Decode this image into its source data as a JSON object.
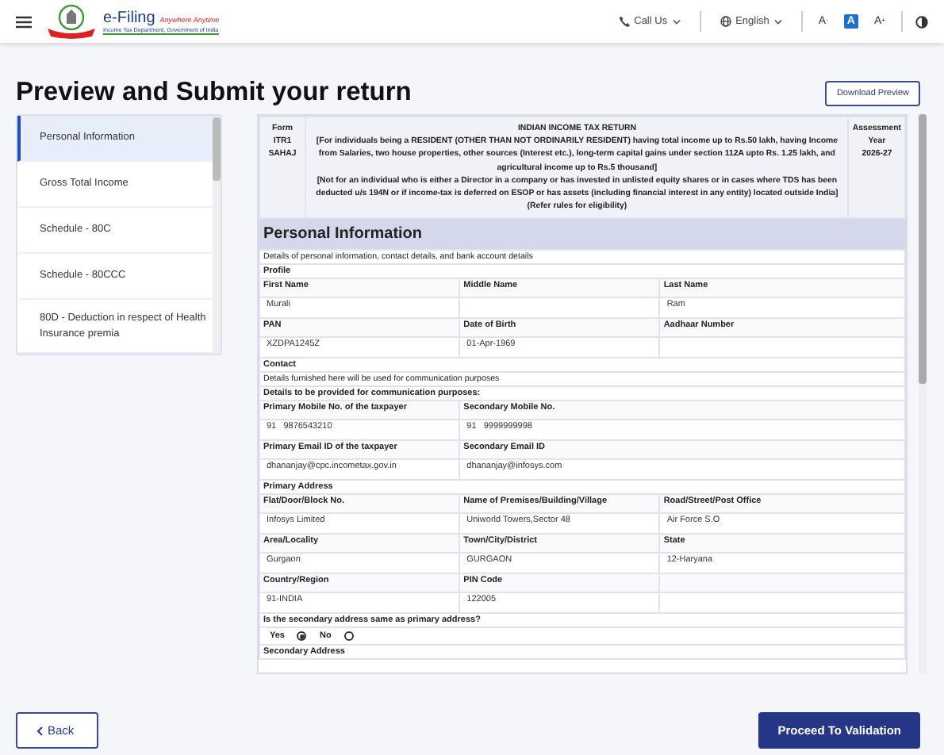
{
  "header": {
    "brand": "e-Filing",
    "tagline": "Anywhere Anytime",
    "subtitle": "Income Tax Department, Government of India",
    "call_us": "Call Us",
    "language": "English",
    "font_controls": [
      {
        "label": "A",
        "sign": "-",
        "selected": false
      },
      {
        "label": "A",
        "selected": true
      },
      {
        "label": "A",
        "sign": "+",
        "selected": false
      }
    ]
  },
  "page_title": "Preview and Submit your return",
  "download_button": "Download Preview",
  "sidebar": {
    "items": [
      {
        "label": "Personal Information",
        "selected": true
      },
      {
        "label": "Gross Total Income",
        "selected": false
      },
      {
        "label": "Schedule - 80C",
        "selected": false
      },
      {
        "label": "Schedule - 80CCC",
        "selected": false
      },
      {
        "label": "80D - Deduction in respect of Health Insurance premia",
        "selected": false
      }
    ]
  },
  "form": {
    "form_lines": [
      "Form",
      "ITR1",
      "SAHAJ"
    ],
    "title": "INDIAN INCOME TAX RETURN",
    "paragraphs": [
      "[For individuals being a RESIDENT (OTHER THAN NOT ORDINARILY RESIDENT) having total income up to Rs.50 lakh, having Income from Salaries, two house properties, other sources (Interest etc.), long-term capital gains under section 112A upto Rs. 1.25 lakh, and agricultural income up to Rs.5 thousand]",
      "[Not for an individual who is either a Director in a company or has invested in unlisted equity shares or in cases where TDS has been deducted u/s 194N or if income-tax is deferred on ESOP or has assets (including financial interest in any entity) located outside India]",
      "(Refer rules for eligibility)"
    ],
    "ay_lines": [
      "Assessment",
      "Year",
      "2026-27"
    ],
    "section_title": "Personal Information",
    "section_note": "Details of personal information, contact details, and bank account details",
    "rows": [
      {
        "kind": "heading",
        "text": "Profile"
      },
      {
        "kind": "labels",
        "cells": [
          {
            "text": "First Name"
          },
          {
            "text": "Middle Name"
          },
          {
            "text": "Last Name"
          }
        ]
      },
      {
        "kind": "values",
        "cells": [
          {
            "text": "Murali"
          },
          {},
          {
            "text": "Ram"
          }
        ]
      },
      {
        "kind": "labels",
        "cells": [
          {
            "text": "PAN"
          },
          {
            "text": "Date of Birth"
          },
          {
            "text": "Aadhaar Number"
          }
        ]
      },
      {
        "kind": "values",
        "cells": [
          {
            "text": "XZDPA1245Z"
          },
          {
            "text": "01-Apr-1969"
          },
          {}
        ]
      },
      {
        "kind": "heading",
        "text": "Contact"
      },
      {
        "kind": "note",
        "text": "Details furnished here will be used for communication purposes"
      },
      {
        "kind": "heading",
        "text": "Details to be provided for communication purposes:"
      },
      {
        "kind": "labels",
        "cells": [
          {
            "text": "Primary Mobile No. of the taxpayer"
          },
          {
            "text": "Secondary Mobile No."
          }
        ]
      },
      {
        "kind": "values",
        "cells": [
          {
            "text": "91   9876543210"
          },
          {
            "text": "91   9999999998"
          }
        ]
      },
      {
        "kind": "labels",
        "cells": [
          {
            "text": "Primary Email ID of the taxpayer"
          },
          {
            "text": "Secondary Email ID"
          }
        ]
      },
      {
        "kind": "values",
        "cells": [
          {
            "text": "dhananjay@cpc.incometax.gov.in"
          },
          {
            "text": "dhananjay@infosys.com"
          }
        ]
      },
      {
        "kind": "heading",
        "text": "Primary Address"
      },
      {
        "kind": "labels",
        "cells": [
          {
            "text": "Flat/Door/Block No."
          },
          {
            "text": "Name of Premises/Building/Village"
          },
          {
            "text": "Road/Street/Post Office"
          }
        ]
      },
      {
        "kind": "values",
        "cells": [
          {
            "text": "Infosys Limited"
          },
          {
            "text": "Uniworld Towers,Sector 48"
          },
          {
            "text": "Air Force S.O"
          }
        ]
      },
      {
        "kind": "labels",
        "cells": [
          {
            "text": "Area/Locality"
          },
          {
            "text": "Town/City/District"
          },
          {
            "text": "State"
          }
        ]
      },
      {
        "kind": "values",
        "cells": [
          {
            "text": "Gurgaon"
          },
          {
            "text": "GURGAON"
          },
          {
            "text": "12-Haryana"
          }
        ]
      },
      {
        "kind": "labels",
        "cells": [
          {
            "text": "Country/Region"
          },
          {
            "text": "PIN Code"
          },
          {}
        ]
      },
      {
        "kind": "values",
        "cells": [
          {
            "text": "91-INDIA"
          },
          {
            "text": "122005"
          },
          {}
        ]
      },
      {
        "kind": "heading",
        "text": "Is the secondary address same as primary address?"
      },
      {
        "kind": "radio",
        "options": [
          {
            "label": "Yes",
            "selected": true
          },
          {
            "label": "No",
            "selected": false
          }
        ]
      },
      {
        "kind": "heading",
        "text": "Secondary Address"
      }
    ]
  },
  "back_button": "Back",
  "proceed_button": "Proceed To Validation"
}
